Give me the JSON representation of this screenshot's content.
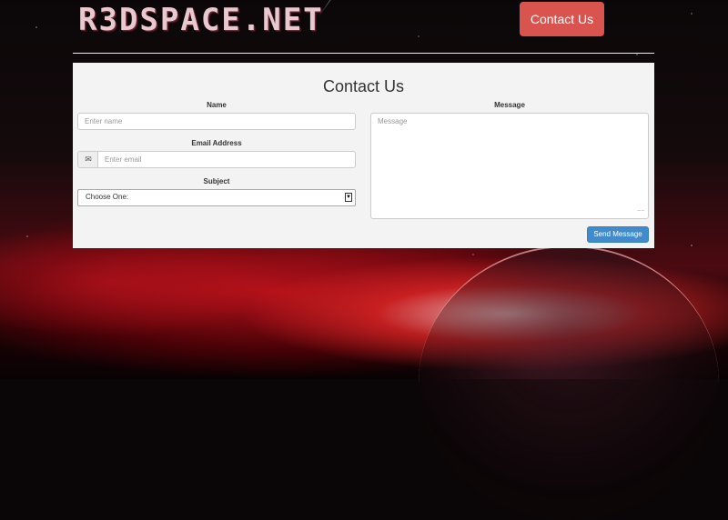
{
  "brand": {
    "logo_text": "R3DSPACE.NET"
  },
  "nav": {
    "contact_label": "Contact Us"
  },
  "form": {
    "title": "Contact Us",
    "name": {
      "label": "Name",
      "placeholder": "Enter name"
    },
    "email": {
      "label": "Email Address",
      "placeholder": "Enter email",
      "icon": "envelope-icon"
    },
    "subject": {
      "label": "Subject",
      "selected": "Choose One:"
    },
    "message": {
      "label": "Message",
      "placeholder": "Message"
    },
    "submit_label": "Send Message"
  },
  "colors": {
    "nav_button": "#d9534f",
    "submit_button": "#428bca",
    "panel_bg": "#f3f3f3"
  }
}
